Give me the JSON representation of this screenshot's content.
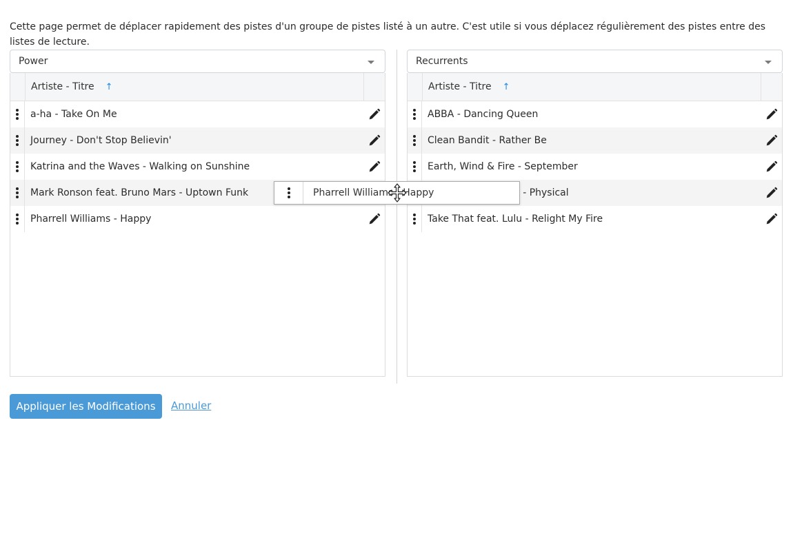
{
  "intro_text": "Cette page permet de déplacer rapidement des pistes d'un groupe de pistes listé à un autre. C'est utile si vous déplacez régulièrement des pistes entre des listes de lecture.",
  "left": {
    "selected_group": "Power",
    "column_header": "Artiste - Titre",
    "sort_indicator": "↑",
    "rows": [
      "a-ha - Take On Me",
      "Journey - Don't Stop Believin'",
      "Katrina and the Waves - Walking on Sunshine",
      "Mark Ronson feat. Bruno Mars - Uptown Funk",
      "Pharrell Williams - Happy"
    ]
  },
  "right": {
    "selected_group": "Recurrents",
    "column_header": "Artiste - Titre",
    "sort_indicator": "↑",
    "rows": [
      "ABBA - Dancing Queen",
      "Clean Bandit - Rather Be",
      "Earth, Wind & Fire - September",
      "Olivia Newton-John - Physical",
      "Take That feat. Lulu - Relight My Fire"
    ],
    "row_4_visible_fragment": "- Physical"
  },
  "drag_ghost": {
    "text": "Pharrell Williams - Happy"
  },
  "actions": {
    "apply_label": "Appliquer les Modifications",
    "cancel_label": "Annuler"
  },
  "colors": {
    "accent": "#4a9ad7",
    "sort_arrow": "#1e88e5"
  },
  "icons": {
    "row_handle": "vertical-dots-icon",
    "row_edit": "pencil-icon",
    "select": "chevron-down-icon",
    "cursor": "move-cursor-icon"
  }
}
